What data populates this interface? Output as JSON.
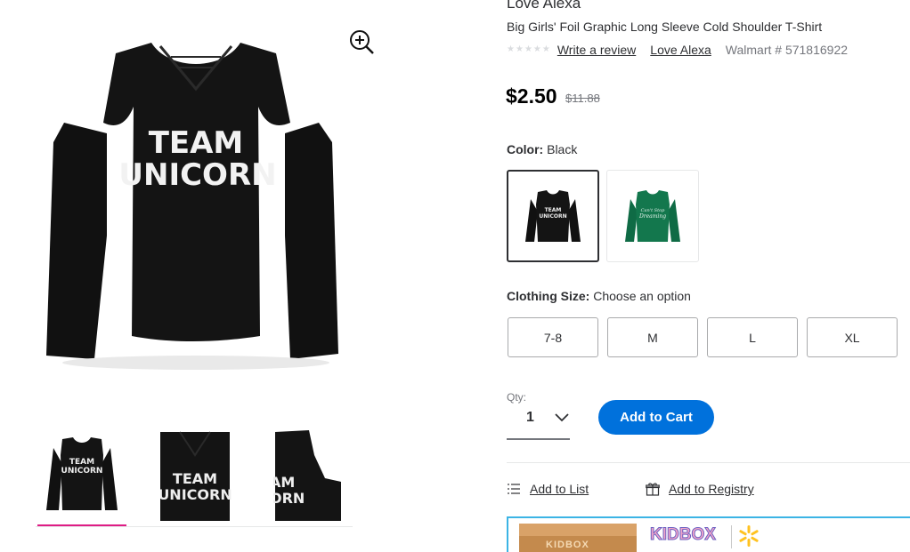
{
  "brand": "Love Alexa",
  "product": {
    "title": "Big Girls' Foil Graphic Long Sleeve Cold Shoulder T-Shirt",
    "review_link": "Write a review",
    "brand_link": "Love Alexa",
    "walmart_number": "Walmart # 571816922",
    "rating_stars": 5,
    "rating_value": 0
  },
  "price": {
    "current": "$2.50",
    "was": "$11.88"
  },
  "color": {
    "label": "Color:",
    "selected": "Black",
    "swatches": [
      {
        "name": "Black",
        "shirt_color": "#111111",
        "text": "TEAM UNICORN"
      },
      {
        "name": "Green",
        "shirt_color": "#0f6b45",
        "text": "Can't Stop Dreaming"
      }
    ]
  },
  "size": {
    "label": "Clothing Size:",
    "prompt": "Choose an option",
    "options": [
      "7-8",
      "M",
      "L",
      "XL"
    ]
  },
  "qty": {
    "label": "Qty:",
    "value": "1"
  },
  "cart": {
    "button": "Add to Cart"
  },
  "actions": {
    "add_to_list": "Add to List",
    "add_to_registry": "Add to Registry"
  },
  "gallery": {
    "main_graphic_line1": "TEAM",
    "main_graphic_line2": "UNICORN",
    "thumb_count": 3
  },
  "ad": {
    "box_text": "KIDBOX",
    "logo_text": "KIDBOX"
  },
  "colors": {
    "accent_blue": "#0071dc",
    "thumb_underline": "#de1c85",
    "text_primary": "#2e2f32",
    "text_muted": "#74767c",
    "ad_border": "#3cb4e5",
    "walmart_spark": "#ffc220"
  }
}
